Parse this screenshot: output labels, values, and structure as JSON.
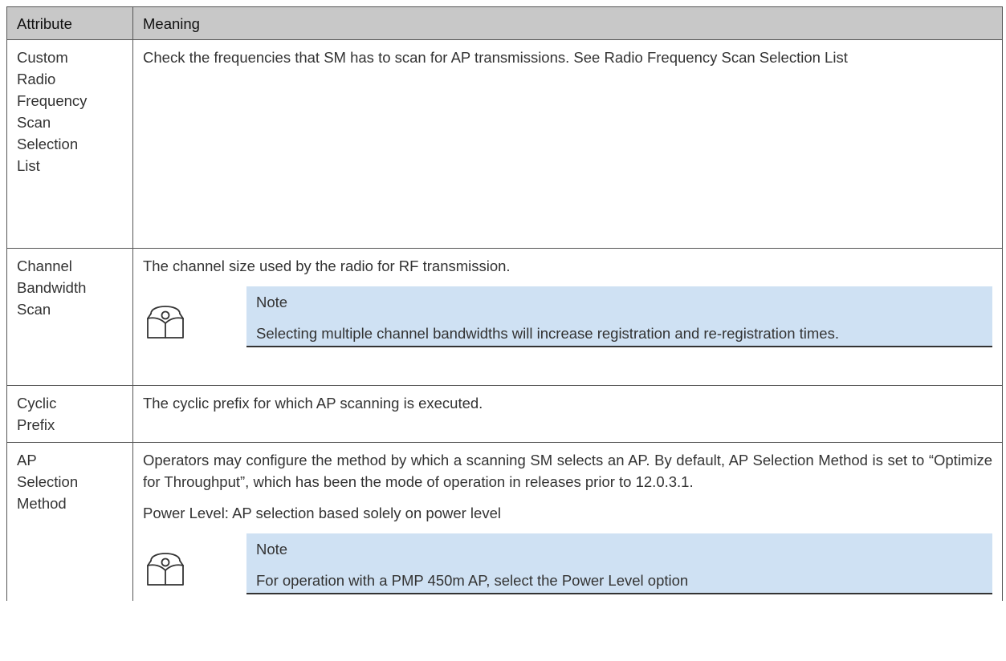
{
  "table": {
    "headers": {
      "attribute": "Attribute",
      "meaning": "Meaning"
    },
    "rows": [
      {
        "attribute": [
          "Custom",
          "Radio",
          "Frequency",
          "Scan",
          "Selection",
          "List"
        ],
        "meaning": "Check the frequencies that SM has to scan for AP transmissions. See Radio Frequency Scan Selection List"
      },
      {
        "attribute": [
          "Channel",
          "Bandwidth",
          "Scan"
        ],
        "meaning": "The channel size used by the radio for RF transmission.",
        "note": {
          "icon": "book-note-icon",
          "title": "Note",
          "body": "Selecting multiple channel bandwidths will increase registration and re-registration times."
        }
      },
      {
        "attribute": [
          "Cyclic",
          "Prefix"
        ],
        "meaning": "The cyclic prefix for which AP scanning is executed."
      },
      {
        "attribute": [
          "AP",
          "Selection",
          "Method"
        ],
        "meaning": "Operators may configure the method by which a scanning SM selects an AP. By default, AP Selection Method is set to “Optimize for Throughput”, which has been the mode of operation in releases prior to 12.0.3.1.",
        "meaning_2": "Power Level: AP selection based solely on power level",
        "note": {
          "icon": "book-note-icon",
          "title": "Note",
          "body": "For operation with a PMP 450m AP, select the Power Level option"
        }
      }
    ]
  },
  "colors": {
    "header_bg": "#c8c8c8",
    "note_bg": "#cfe1f3",
    "border": "#555555"
  }
}
